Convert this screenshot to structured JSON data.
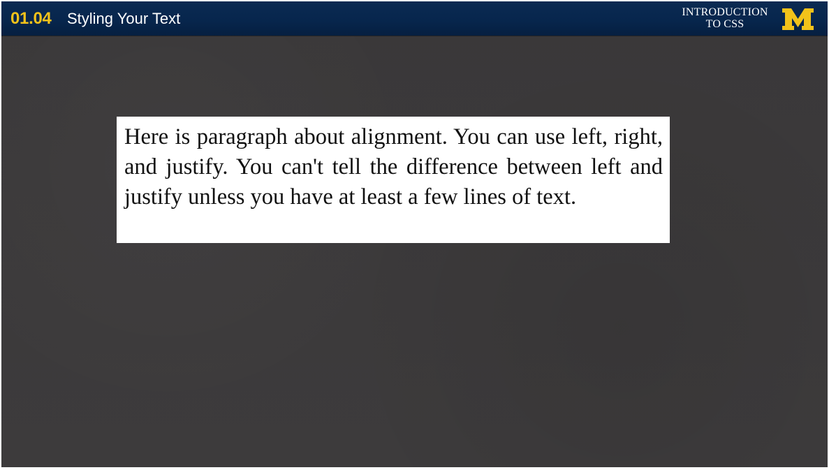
{
  "header": {
    "lesson_number": "01.04",
    "lesson_title": "Styling Your Text",
    "course_line_1": "INTRODUCTION",
    "course_line_2": "TO CSS",
    "logo_letter": "M"
  },
  "content": {
    "paragraph": "Here is paragraph about alignment. You can use left, right, and justify. You can't tell the difference between left and justify unless you have at least a few lines of text."
  },
  "colors": {
    "header_bg": "#07264d",
    "accent": "#f2c21a",
    "background": "#3b393a",
    "card_bg": "#ffffff",
    "text": "#111111"
  }
}
